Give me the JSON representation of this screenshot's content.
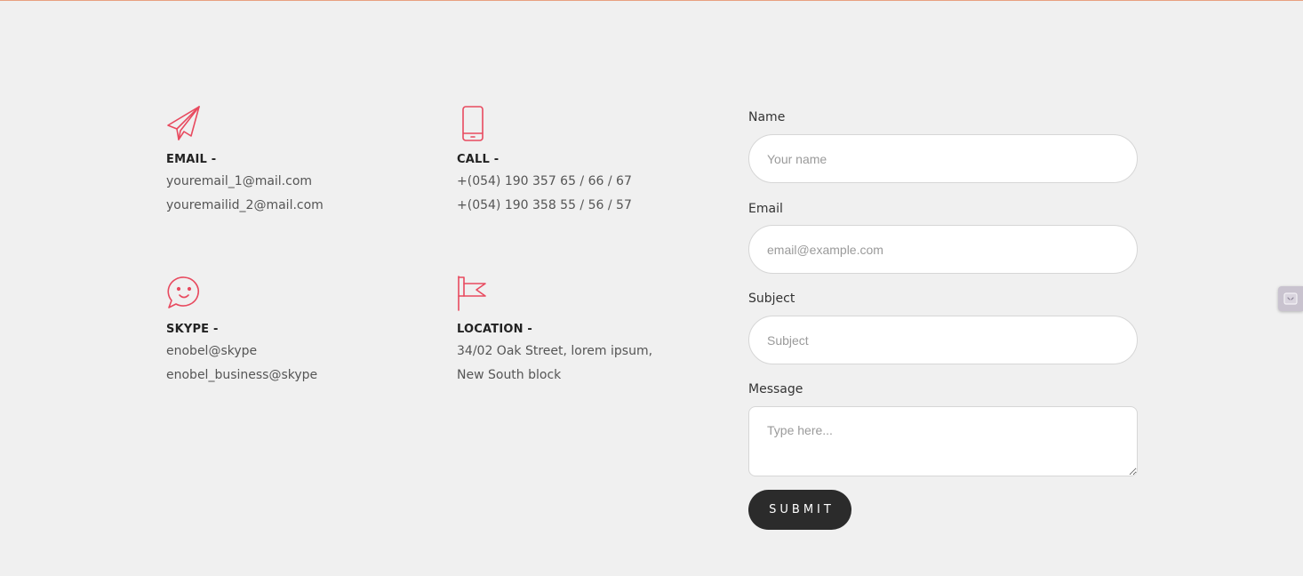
{
  "colors": {
    "accent": "#e84a5f",
    "background": "#f0f0f0",
    "button": "#2b2b2b"
  },
  "contact": {
    "email": {
      "icon": "paper-plane-icon",
      "title": "EMAIL -",
      "lines": [
        "youremail_1@mail.com",
        "youremailid_2@mail.com"
      ]
    },
    "call": {
      "icon": "smartphone-icon",
      "title": "CALL -",
      "lines": [
        "+(054) 190 357 65 / 66 / 67",
        "+(054) 190 358 55 / 56 / 57"
      ]
    },
    "skype": {
      "icon": "chat-bubble-smile-icon",
      "title": "SKYPE -",
      "lines": [
        "enobel@skype",
        "enobel_business@skype"
      ]
    },
    "location": {
      "icon": "flag-icon",
      "title": "LOCATION -",
      "lines": [
        "34/02 Oak Street, lorem ipsum,",
        "New South block"
      ]
    }
  },
  "form": {
    "name": {
      "label": "Name",
      "placeholder": "Your name"
    },
    "email": {
      "label": "Email",
      "placeholder": "email@example.com"
    },
    "subject": {
      "label": "Subject",
      "placeholder": "Subject"
    },
    "message": {
      "label": "Message",
      "placeholder": "Type here..."
    },
    "submit_label": "SUBMIT"
  },
  "side_widget": {
    "icon": "message-widget-icon"
  }
}
